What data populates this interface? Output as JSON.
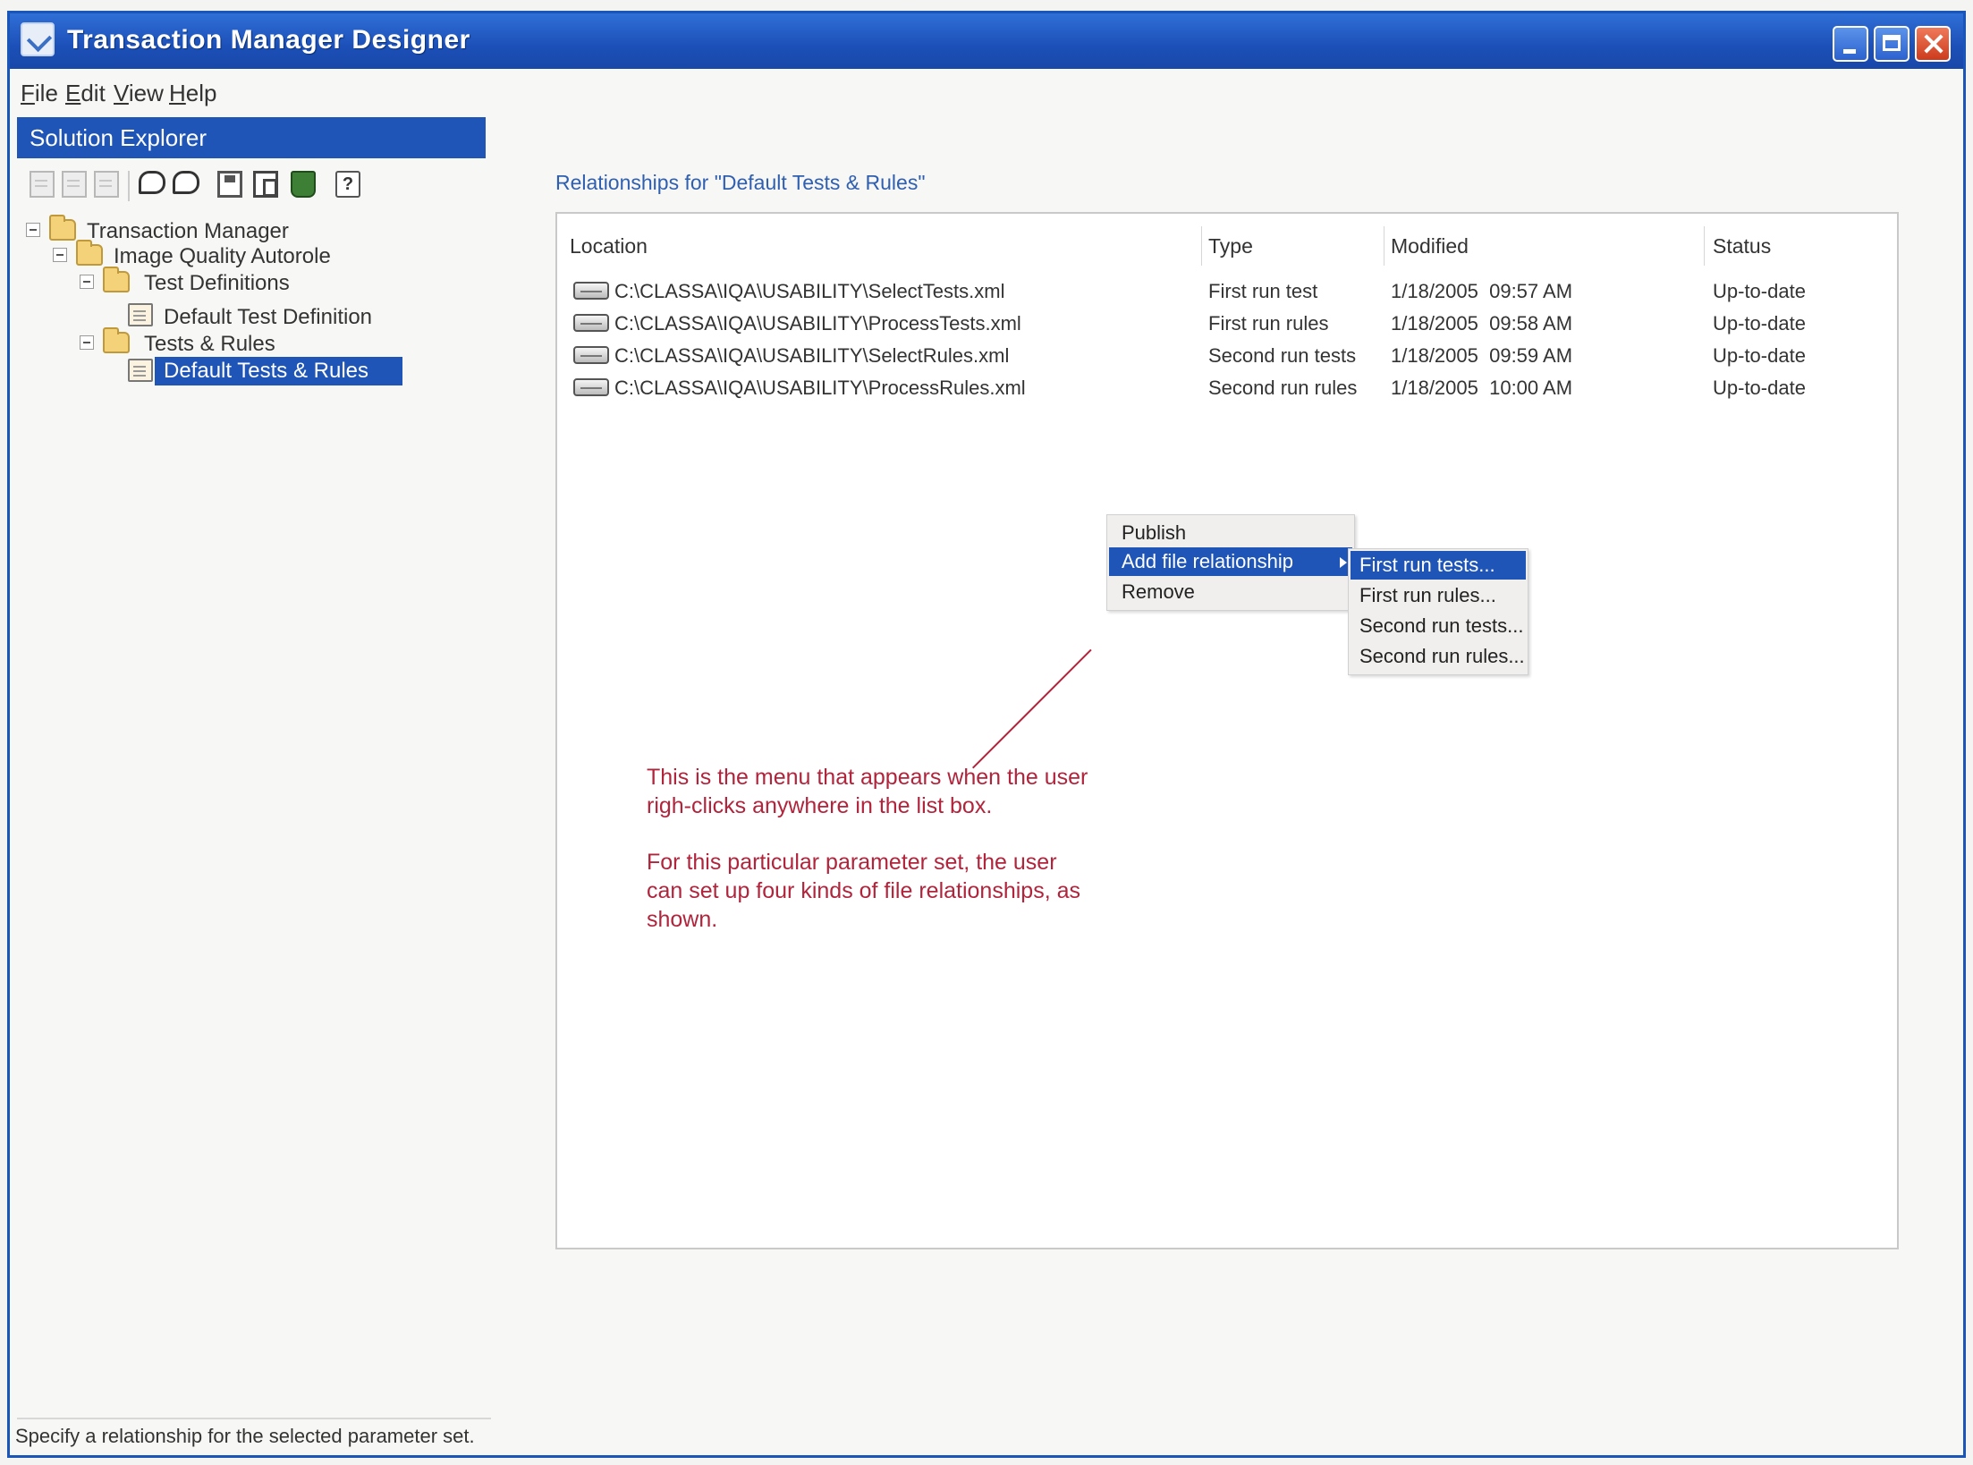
{
  "window": {
    "title": "Transaction Manager Designer"
  },
  "menu": [
    "File",
    "Edit",
    "View",
    "Help"
  ],
  "solution_explorer": {
    "header": "Solution Explorer",
    "toolbar_icons": [
      "new-document-icon",
      "open-document-icon",
      "link-icon",
      "speech-bubble-icon",
      "speech-bubble-icon",
      "save-icon",
      "copy-icon",
      "trash-icon",
      "help-icon"
    ],
    "tree": [
      {
        "label": "Transaction Manager",
        "icon": "folder-icon",
        "expanded": true
      },
      {
        "label": "Image Quality Autorole",
        "icon": "folder-icon",
        "expanded": true
      },
      {
        "label": "Test Definitions",
        "icon": "folder-icon",
        "expanded": true
      },
      {
        "label": "Default Test Definition",
        "icon": "document-icon"
      },
      {
        "label": "Tests & Rules",
        "icon": "folder-icon",
        "expanded": true
      },
      {
        "label": "Default Tests & Rules",
        "icon": "document-icon",
        "selected": true
      }
    ]
  },
  "relationships": {
    "title": "Relationships for \"Default Tests & Rules\"",
    "columns": [
      "Location",
      "Type",
      "Modified",
      "Status"
    ],
    "rows": [
      {
        "location": "C:\\CLASSA\\IQA\\USABILITY\\SelectTests.xml",
        "type": "First run test",
        "modified": "1/18/2005  09:57 AM",
        "status": "Up-to-date"
      },
      {
        "location": "C:\\CLASSA\\IQA\\USABILITY\\ProcessTests.xml",
        "type": "First run rules",
        "modified": "1/18/2005  09:58 AM",
        "status": "Up-to-date"
      },
      {
        "location": "C:\\CLASSA\\IQA\\USABILITY\\SelectRules.xml",
        "type": "Second run tests",
        "modified": "1/18/2005  09:59 AM",
        "status": "Up-to-date"
      },
      {
        "location": "C:\\CLASSA\\IQA\\USABILITY\\ProcessRules.xml",
        "type": "Second run rules",
        "modified": "1/18/2005  10:00 AM",
        "status": "Up-to-date"
      }
    ]
  },
  "context_menu": {
    "items": [
      "Publish",
      "Add file relationship",
      "Remove"
    ],
    "highlighted": "Add file relationship",
    "submenu": [
      "First run tests...",
      "First run rules...",
      "Second run tests...",
      "Second run rules..."
    ],
    "submenu_highlighted": "First run tests..."
  },
  "annotation": {
    "line1": "This is the menu that appears when the user",
    "line2": "righ-clicks anywhere in the list box.",
    "line3": "For this particular parameter set, the user",
    "line4": "can set up four kinds of file relationships, as",
    "line5": "shown.",
    "color": "#b0243c"
  },
  "status_bar": "Specify a relationship for the selected parameter set.",
  "colors": {
    "titlebar": "#1c50b8",
    "selection": "#1f55b6",
    "link_text": "#2f5fb0"
  }
}
